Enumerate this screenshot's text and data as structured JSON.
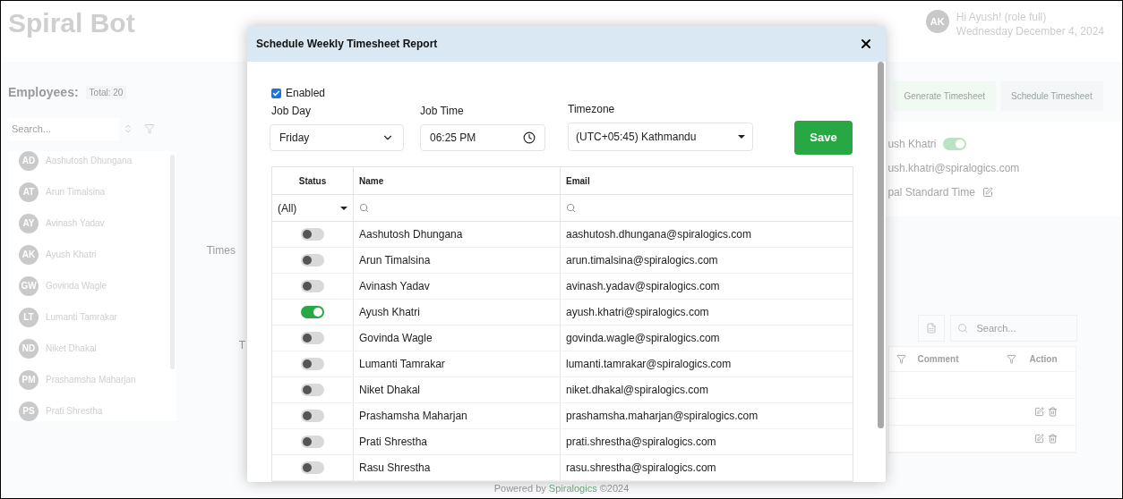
{
  "header": {
    "logo": "Spiral Bot",
    "avatar": "AK",
    "greeting": "Hi Ayush! (role full)",
    "date": "Wednesday December 4, 2024"
  },
  "sidebar": {
    "title": "Employees:",
    "total": "Total: 20",
    "search_placeholder": "Search...",
    "employees": [
      {
        "initials": "AD",
        "name": "Aashutosh Dhungana"
      },
      {
        "initials": "AT",
        "name": "Arun Timalsina"
      },
      {
        "initials": "AY",
        "name": "Avinash Yadav"
      },
      {
        "initials": "AK",
        "name": "Ayush Khatri"
      },
      {
        "initials": "GW",
        "name": "Govinda Wagle"
      },
      {
        "initials": "LT",
        "name": "Lumanti Tamrakar"
      },
      {
        "initials": "ND",
        "name": "Niket Dhakal"
      },
      {
        "initials": "PM",
        "name": "Prashamsha Maharjan"
      },
      {
        "initials": "PS",
        "name": "Prati Shrestha"
      }
    ]
  },
  "main": {
    "section_label": "Times",
    "cut_text": "T"
  },
  "right_panel": {
    "buttons": [
      "Generate Timesheet",
      "Schedule Timesheet"
    ],
    "profile": {
      "name": "ush Khatri",
      "active": true,
      "email": "ush.khatri@spiralogics.com",
      "timezone": "pal Standard Time"
    },
    "table": {
      "search_placeholder": "Search...",
      "columns": [
        "Comment",
        "Action"
      ],
      "rows": [
        {
          "actions": false
        },
        {
          "actions": true
        },
        {
          "actions": true
        }
      ]
    }
  },
  "footer": {
    "text": "Powered by",
    "link": "Spiralogics",
    "suffix": "©2024"
  },
  "dialog": {
    "title": "Schedule Weekly Timesheet Report",
    "enabled": {
      "label": "Enabled",
      "checked": true
    },
    "job_day": {
      "label": "Job Day",
      "value": "Friday"
    },
    "job_time": {
      "label": "Job Time",
      "value": "06:25 PM"
    },
    "timezone": {
      "label": "Timezone",
      "value": "(UTC+05:45) Kathmandu"
    },
    "save": "Save",
    "table": {
      "columns": [
        "Status",
        "Name",
        "Email"
      ],
      "status_filter": "(All)",
      "rows": [
        {
          "on": false,
          "name": "Aashutosh Dhungana",
          "email": "aashutosh.dhungana@spiralogics.com"
        },
        {
          "on": false,
          "name": "Arun Timalsina",
          "email": "arun.timalsina@spiralogics.com"
        },
        {
          "on": false,
          "name": "Avinash Yadav",
          "email": "avinash.yadav@spiralogics.com"
        },
        {
          "on": true,
          "name": "Ayush Khatri",
          "email": "ayush.khatri@spiralogics.com"
        },
        {
          "on": false,
          "name": "Govinda Wagle",
          "email": "govinda.wagle@spiralogics.com"
        },
        {
          "on": false,
          "name": "Lumanti Tamrakar",
          "email": "lumanti.tamrakar@spiralogics.com"
        },
        {
          "on": false,
          "name": "Niket Dhakal",
          "email": "niket.dhakal@spiralogics.com"
        },
        {
          "on": false,
          "name": "Prashamsha Maharjan",
          "email": "prashamsha.maharjan@spiralogics.com"
        },
        {
          "on": false,
          "name": "Prati Shrestha",
          "email": "prati.shrestha@spiralogics.com"
        },
        {
          "on": false,
          "name": "Rasu Shrestha",
          "email": "rasu.shrestha@spiralogics.com"
        }
      ]
    }
  }
}
